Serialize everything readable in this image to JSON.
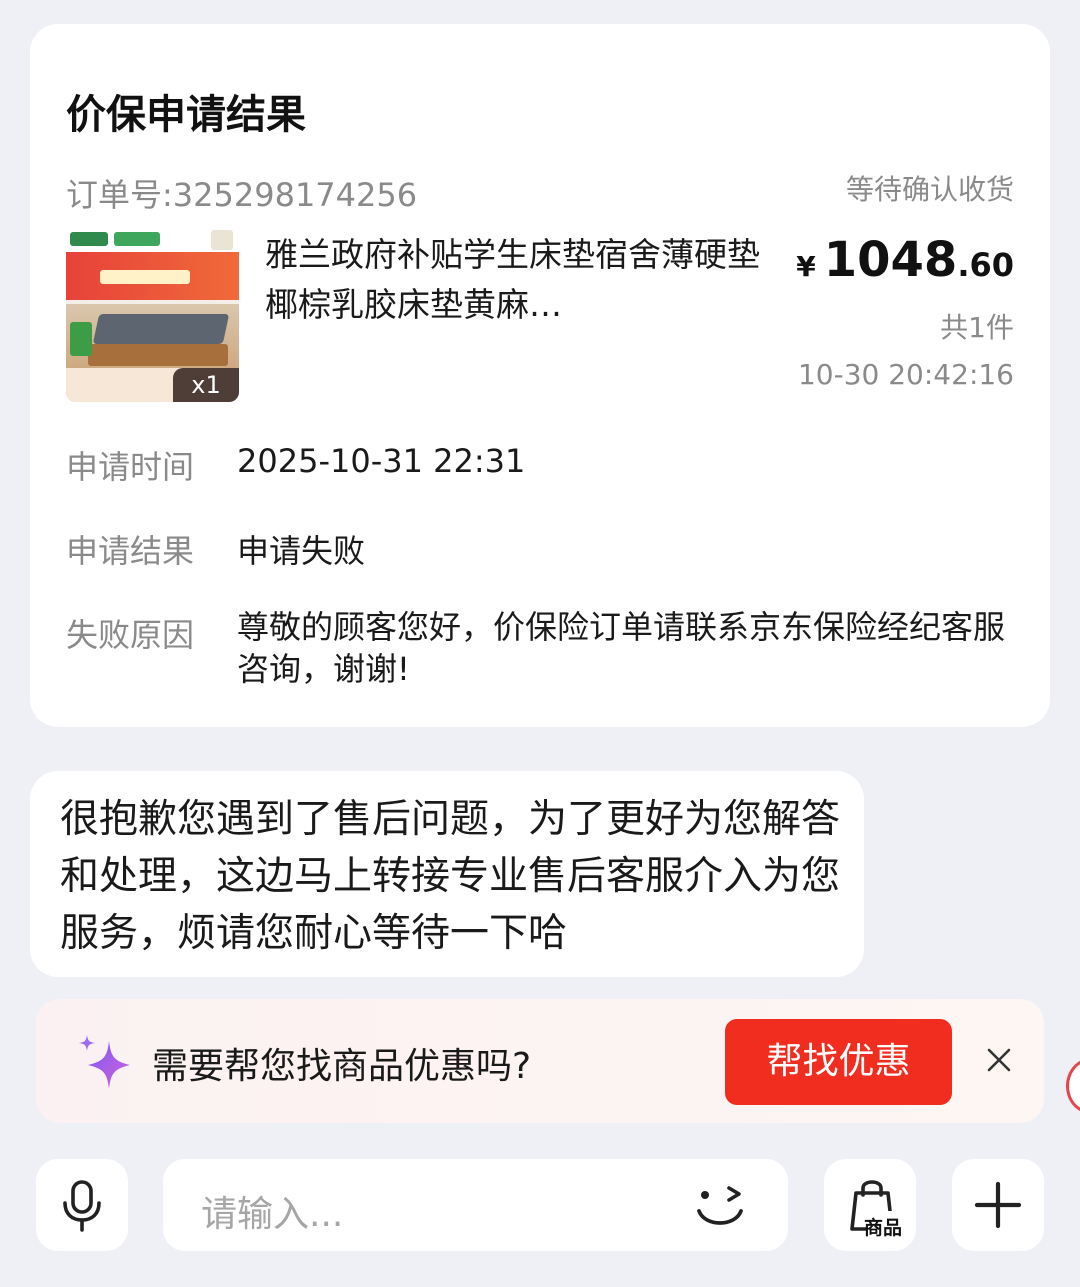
{
  "card": {
    "title": "价保申请结果",
    "order_no": "订单号:325298174256",
    "status": "等待确认收货",
    "product": {
      "name": "雅兰政府补贴学生床垫宿舍薄硬垫椰棕乳胶床垫黄麻…",
      "quantity_badge": "x1",
      "price_symbol": "¥",
      "price_integer": "1048",
      "price_decimal": ".60",
      "count": "共1件",
      "order_time": "10-30 20:42:16"
    },
    "rows": [
      {
        "label": "申请时间",
        "value": "2025-10-31 22:31"
      },
      {
        "label": "申请结果",
        "value": "申请失败"
      },
      {
        "label": "失败原因",
        "value": "尊敬的顾客您好，价保险订单请联系京东保险经纪客服咨询，谢谢!"
      }
    ]
  },
  "message": {
    "text": "很抱歉您遇到了售后问题，为了更好为您解答和处理，这边马上转接专业售后客服介入为您服务，烦请您耐心等待一下哈"
  },
  "promo": {
    "text": "需要帮您找商品优惠吗?",
    "button": "帮找优惠",
    "sparkle_icon": "sparkle-icon",
    "close_icon": "close-icon"
  },
  "input_bar": {
    "placeholder": "请输入...",
    "goods_label": "商品",
    "icons": [
      "microphone-icon",
      "emoji-icon",
      "shopping-bag-icon",
      "plus-icon"
    ]
  },
  "colors": {
    "accent_red": "#f02d1f",
    "background": "#eef0f5",
    "muted_text": "#8a8a8a"
  }
}
